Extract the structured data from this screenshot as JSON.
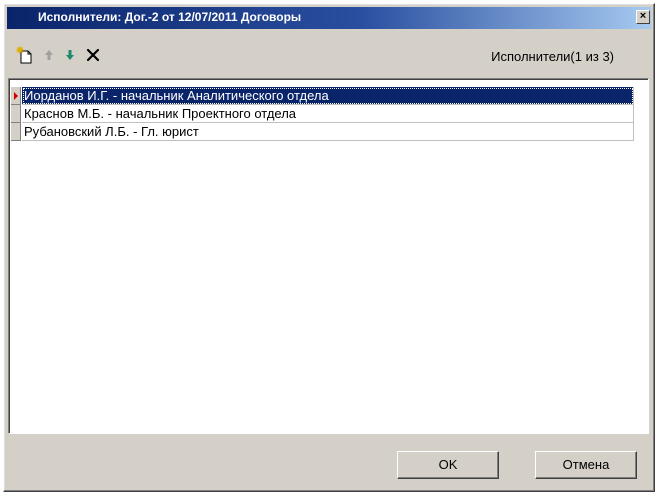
{
  "window": {
    "title": "Исполнители: Дог.-2 от 12/07/2011 Договоры",
    "close_label": "×"
  },
  "toolbar": {
    "buttons": [
      {
        "name": "add",
        "icon": "new-document-icon"
      },
      {
        "name": "move-up",
        "icon": "arrow-up-icon"
      },
      {
        "name": "move-down",
        "icon": "arrow-down-icon"
      },
      {
        "name": "delete",
        "icon": "close-x-icon"
      }
    ],
    "counter": "Исполнители(1 из 3)"
  },
  "list": {
    "rows": [
      {
        "text": "Иорданов И.Г. - начальник Аналитического отдела",
        "selected": true
      },
      {
        "text": "Краснов М.Б. - начальник Проектного отдела",
        "selected": false
      },
      {
        "text": "Рубановский Л.Б. - Гл. юрист",
        "selected": false
      }
    ]
  },
  "buttons": {
    "ok_label": "OK",
    "cancel_label": "Отмена"
  },
  "colors": {
    "selection": "#0a246a",
    "title_start": "#0a246a",
    "title_end": "#a6caf0",
    "down_arrow": "#1e8a6e",
    "indicator_arrow": "#d40000"
  }
}
